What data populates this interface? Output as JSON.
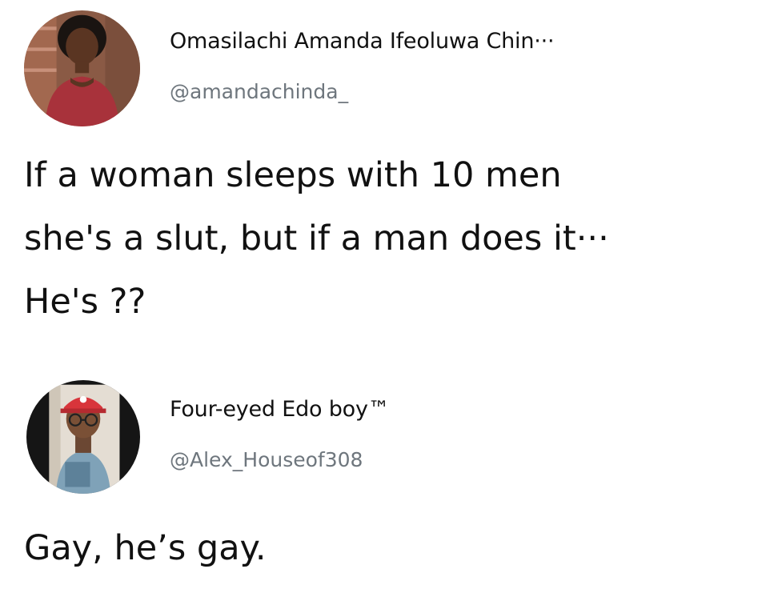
{
  "tweets": [
    {
      "display_name": "Omasilachi Amanda Ifeoluwa Chin···",
      "handle": "@amandachinda_",
      "text_lines": [
        "If a woman sleeps with 10 men",
        "she's a slut, but if a man does it···",
        "He's ??"
      ]
    },
    {
      "display_name": "Four-eyed Edo boy™",
      "handle": "@Alex_Houseof308",
      "text_lines": [
        "Gay, he’s gay."
      ]
    }
  ]
}
